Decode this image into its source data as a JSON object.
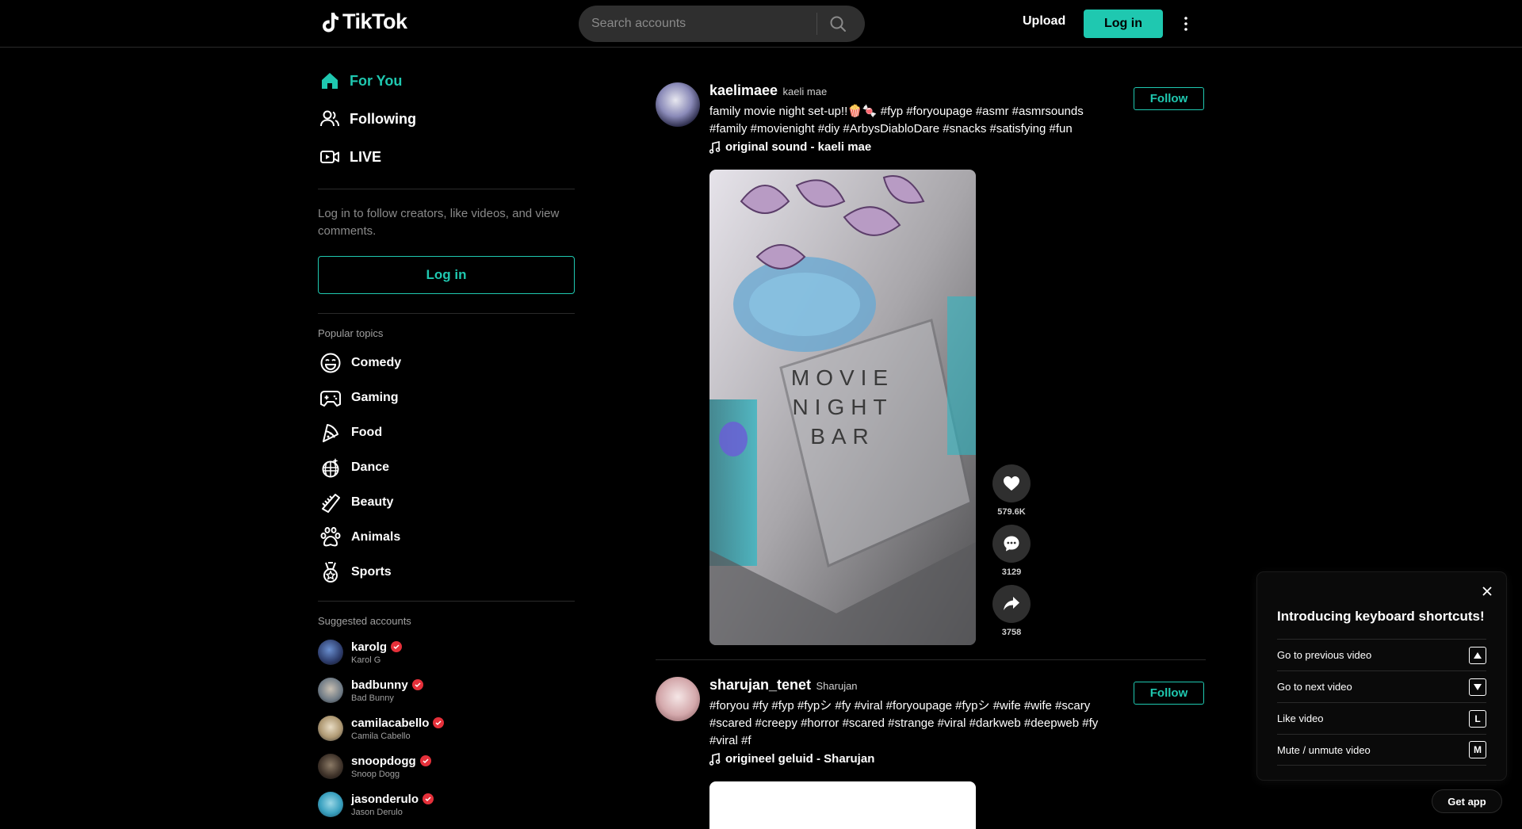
{
  "header": {
    "logo_text": "TikTok",
    "search_placeholder": "Search accounts",
    "upload_label": "Upload",
    "login_label": "Log in"
  },
  "sidebar": {
    "nav": [
      {
        "label": "For You",
        "icon": "home-icon",
        "active": true
      },
      {
        "label": "Following",
        "icon": "people-icon"
      },
      {
        "label": "LIVE",
        "icon": "live-icon"
      }
    ],
    "login_hint": "Log in to follow creators, like videos, and view comments.",
    "login_label": "Log in",
    "topics_title": "Popular topics",
    "topics": [
      {
        "label": "Comedy",
        "icon": "comedy-icon"
      },
      {
        "label": "Gaming",
        "icon": "gaming-icon"
      },
      {
        "label": "Food",
        "icon": "food-icon"
      },
      {
        "label": "Dance",
        "icon": "dance-icon"
      },
      {
        "label": "Beauty",
        "icon": "beauty-icon"
      },
      {
        "label": "Animals",
        "icon": "animals-icon"
      },
      {
        "label": "Sports",
        "icon": "sports-icon"
      }
    ],
    "accounts_title": "Suggested accounts",
    "accounts": [
      {
        "username": "karolg",
        "name": "Karol G"
      },
      {
        "username": "badbunny",
        "name": "Bad Bunny"
      },
      {
        "username": "camilacabello",
        "name": "Camila Cabello"
      },
      {
        "username": "snoopdogg",
        "name": "Snoop Dogg"
      },
      {
        "username": "jasonderulo",
        "name": "Jason Derulo"
      }
    ]
  },
  "posts": [
    {
      "username": "kaelimaee",
      "display_name": "kaeli mae",
      "caption": "family movie night set-up!!🍿🍬 #fyp #foryoupage #asmr #asmrsounds #family #movienight #diy #ArbysDiabloDare #snacks #satisfying #fun",
      "music": "original sound - kaeli mae",
      "follow_label": "Follow",
      "video_text": "MOVIE NIGHT BAR",
      "likes": "579.6K",
      "comments": "3129",
      "shares": "3758"
    },
    {
      "username": "sharujan_tenet",
      "display_name": "Sharujan",
      "caption": "#foryou #fy #fyp #fypシ #fy #viral #foryoupage #fypシ #wife #wife #scary #scared #creepy #horror #scared #strange #viral #darkweb #deepweb #fy #viral #f",
      "music": "origineel geluid - Sharujan",
      "follow_label": "Follow"
    }
  ],
  "shortcuts": {
    "title": "Introducing keyboard shortcuts!",
    "items": [
      {
        "label": "Go to previous video",
        "key": "▲"
      },
      {
        "label": "Go to next video",
        "key": "▼"
      },
      {
        "label": "Like video",
        "key": "L"
      },
      {
        "label": "Mute / unmute video",
        "key": "M"
      }
    ]
  },
  "get_app_label": "Get app",
  "colors": {
    "accent": "#1fc8b0",
    "background": "#000000",
    "verified": "#e5303a"
  }
}
